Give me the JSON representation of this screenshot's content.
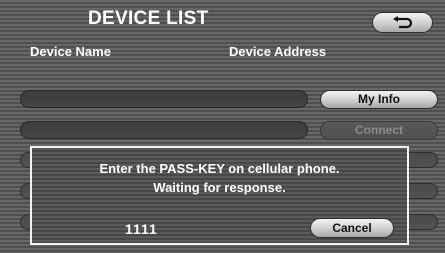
{
  "screen": {
    "title": "DEVICE LIST",
    "back_icon": "return-arrow-icon"
  },
  "list": {
    "columns": [
      "Device Name",
      "Device Address"
    ],
    "rows": [
      {
        "name": "",
        "address": "",
        "action_label": "My Info",
        "action_enabled": true
      },
      {
        "name": "",
        "address": "",
        "action_label": "Connect",
        "action_enabled": false
      }
    ]
  },
  "dialog": {
    "message_line1": "Enter the PASS-KEY on cellular phone.",
    "message_line2": "Waiting for response.",
    "passkey": "1111",
    "cancel_label": "Cancel"
  },
  "colors": {
    "background": "#5c5c5c",
    "text": "#ffffff",
    "dialog_border": "#f2f2f2",
    "button_face": "#cfcfcf",
    "disabled_text": "#8c8c8c"
  }
}
